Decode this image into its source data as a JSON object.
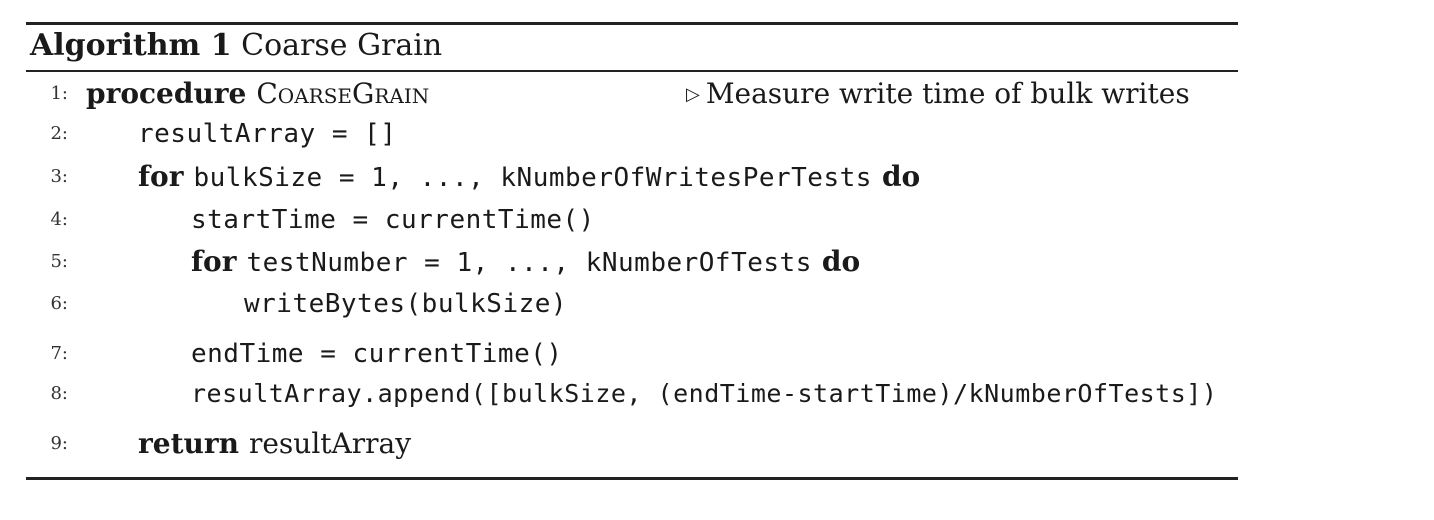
{
  "algorithm": {
    "label": "Algorithm 1",
    "title": "Coarse Grain",
    "lines": [
      {
        "num": "1:",
        "keyword": "procedure",
        "name": "CoarseGrain",
        "comment": "Measure write time of bulk writes"
      },
      {
        "num": "2:",
        "code": "resultArray = []"
      },
      {
        "num": "3:",
        "keyword": "for",
        "code": "bulkSize = 1, ..., kNumberOfWritesPerTests",
        "keyword_end": "do"
      },
      {
        "num": "4:",
        "code": "startTime = currentTime()"
      },
      {
        "num": "5:",
        "keyword": "for",
        "code": "testNumber = 1, ..., kNumberOfTests",
        "keyword_end": "do"
      },
      {
        "num": "6:",
        "code": "writeBytes(bulkSize)"
      },
      {
        "num": "7:",
        "code": "endTime = currentTime()"
      },
      {
        "num": "8:",
        "code": "resultArray.append([bulkSize, (endTime-startTime)/kNumberOfTests])"
      },
      {
        "num": "9:",
        "keyword": "return",
        "text": "resultArray"
      }
    ]
  }
}
